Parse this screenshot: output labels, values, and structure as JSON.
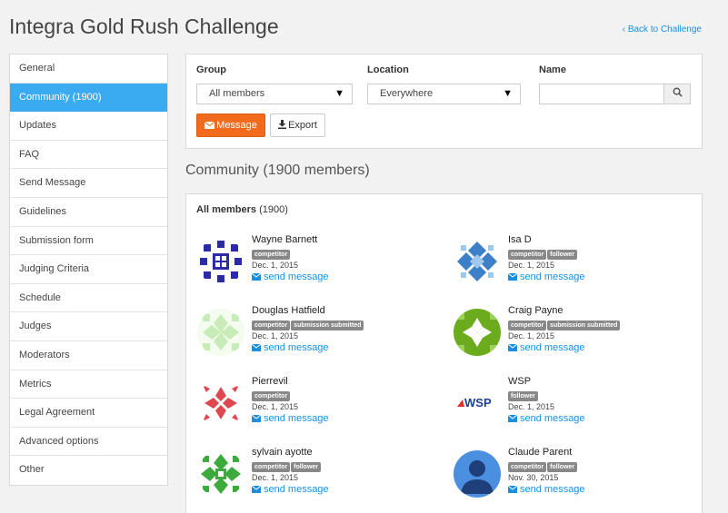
{
  "page": {
    "title": "Integra Gold Rush Challenge",
    "back_link": "‹ Back to Challenge"
  },
  "sidebar": {
    "items": [
      {
        "label": "General"
      },
      {
        "label": "Community (1900)",
        "active": true
      },
      {
        "label": "Updates"
      },
      {
        "label": "FAQ"
      },
      {
        "label": "Send Message"
      },
      {
        "label": "Guidelines"
      },
      {
        "label": "Submission form"
      },
      {
        "label": "Judging Criteria"
      },
      {
        "label": "Schedule"
      },
      {
        "label": "Judges"
      },
      {
        "label": "Moderators"
      },
      {
        "label": "Metrics"
      },
      {
        "label": "Legal Agreement"
      },
      {
        "label": "Advanced options"
      },
      {
        "label": "Other"
      }
    ]
  },
  "filters": {
    "group_label": "Group",
    "group_value": "All members",
    "location_label": "Location",
    "location_value": "Everywhere",
    "name_label": "Name",
    "name_value": "",
    "message_button": "Message",
    "export_button": "Export"
  },
  "community": {
    "heading_main": "Community",
    "heading_count": "(1900 members)",
    "panel_title": "All members",
    "panel_count": "(1900)",
    "send_label": "send message",
    "members": [
      {
        "name": "Wayne Barnett",
        "badges": [
          "competitor"
        ],
        "date": "Dec. 1, 2015",
        "avatar": "blue-pattern-icon"
      },
      {
        "name": "Isa D",
        "badges": [
          "competitor",
          "follower"
        ],
        "date": "Dec. 1, 2015",
        "avatar": "blue-diamond-pattern-icon"
      },
      {
        "name": "Douglas Hatfield",
        "badges": [
          "competitor",
          "submission submitted"
        ],
        "date": "Dec. 1, 2015",
        "avatar": "light-green-pattern-icon"
      },
      {
        "name": "Craig Payne",
        "badges": [
          "competitor",
          "submission submitted"
        ],
        "date": "Dec. 1, 2015",
        "avatar": "green-pattern-icon"
      },
      {
        "name": "Pierrevil",
        "badges": [
          "competitor"
        ],
        "date": "Dec. 1, 2015",
        "avatar": "red-pattern-icon"
      },
      {
        "name": "WSP",
        "badges": [
          "follower"
        ],
        "date": "Dec. 1, 2015",
        "avatar": "wsp-logo",
        "logo_text": "WSP"
      },
      {
        "name": "sylvain ayotte",
        "badges": [
          "competitor",
          "follower"
        ],
        "date": "Dec. 1, 2015",
        "avatar": "green-pattern-icon"
      },
      {
        "name": "Claude Parent",
        "badges": [
          "competitor",
          "follower"
        ],
        "date": "Nov. 30, 2015",
        "avatar": "default-person-icon"
      }
    ]
  },
  "colors": {
    "accent": "#3aabf0",
    "message_button": "#f26b1d",
    "link": "#1a8fe0",
    "badge": "#888888"
  }
}
